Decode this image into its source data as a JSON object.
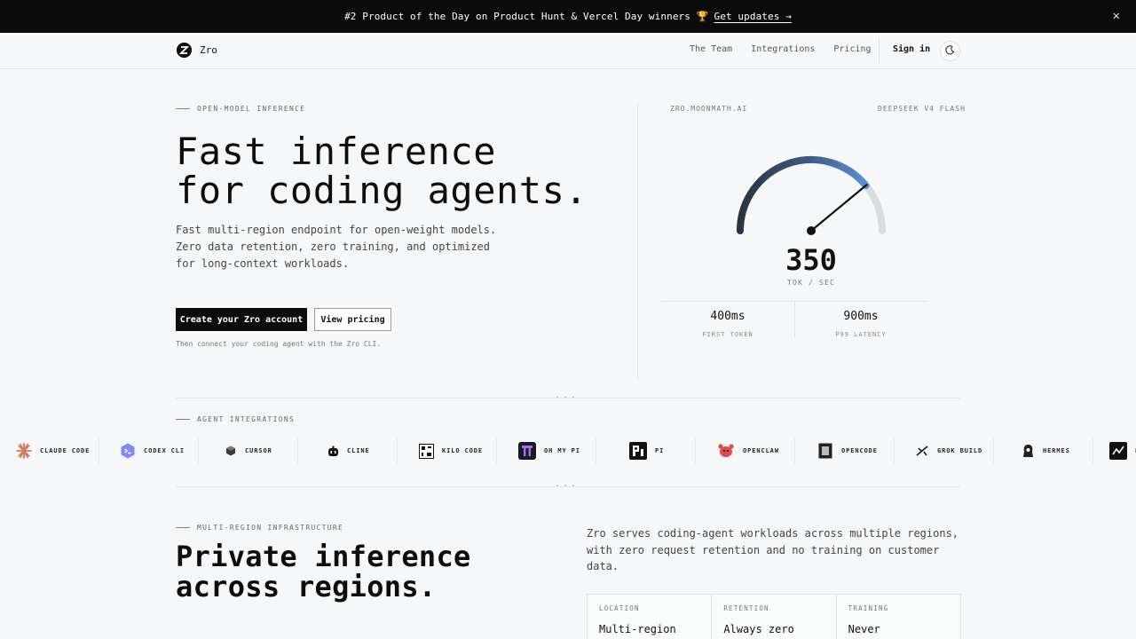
{
  "announcement": {
    "text": "#2 Product of the Day on Product Hunt & Vercel Day winners 🏆",
    "link": "Get updates →",
    "close_icon": "✕"
  },
  "nav": {
    "brand": "Zro",
    "links": [
      "The Team",
      "Integrations",
      "Pricing"
    ],
    "sign_in": "Sign in",
    "theme_icon": "moon-icon"
  },
  "hero": {
    "eyebrow": "OPEN-MODEL INFERENCE",
    "title_line1": "Fast inference",
    "title_line2": "for coding agents.",
    "desc_line1": "Fast multi-region endpoint for open-weight models.",
    "desc_line2": "Zero data retention, zero training, and optimized",
    "desc_line3": "for long-context workloads.",
    "primary_button": "Create your Zro account",
    "secondary_button": "View pricing",
    "hint": "Then connect your coding agent with the Zro CLI."
  },
  "speed_panel": {
    "host": "ZRO.MOONMATH.AI",
    "model": "DEEPSEEK V4 FLASH",
    "value": "350",
    "unit": "TOK / SEC",
    "gauge_fraction": 0.78,
    "stats": [
      {
        "value": "400ms",
        "label": "FIRST TOKEN"
      },
      {
        "value": "900ms",
        "label": "P99 LATENCY"
      }
    ]
  },
  "integrations": {
    "eyebrow": "AGENT INTEGRATIONS",
    "dots": "...",
    "agents": [
      {
        "label": "CLAUDE CODE",
        "icon": "claude-burst-icon",
        "color": "#d97757"
      },
      {
        "label": "CODEX CLI",
        "icon": "codex-terminal-icon",
        "color": "#6b7cf5"
      },
      {
        "label": "CURSOR",
        "icon": "cursor-cube-icon",
        "color": "#333333"
      },
      {
        "label": "CLINE",
        "icon": "cline-robot-icon",
        "color": "#111111"
      },
      {
        "label": "KILO CODE",
        "icon": "kilo-grid-icon",
        "color": "#111111"
      },
      {
        "label": "OH MY PI",
        "icon": "oh-my-pi-icon",
        "color": "#5a2ea6"
      },
      {
        "label": "PI",
        "icon": "pi-icon",
        "color": "#111111"
      },
      {
        "label": "OPENCLAW",
        "icon": "openclaw-icon",
        "color": "#e24a4a"
      },
      {
        "label": "OPENCODE",
        "icon": "opencode-icon",
        "color": "#222222"
      },
      {
        "label": "GROK BUILD",
        "icon": "grok-icon",
        "color": "#111111"
      },
      {
        "label": "HERMES",
        "icon": "hermes-icon",
        "color": "#222222"
      },
      {
        "label": "P",
        "icon": "trend-icon",
        "color": "#111111"
      }
    ]
  },
  "infrastructure": {
    "eyebrow": "MULTI-REGION INFRASTRUCTURE",
    "title_line1": "Private inference",
    "title_line2": "across regions.",
    "desc": "Zro serves coding-agent workloads across multiple regions, with zero request retention and no training on customer data.",
    "table": [
      {
        "key": "LOCATION",
        "value": "Multi-region"
      },
      {
        "key": "RETENTION",
        "value": "Always zero"
      },
      {
        "key": "TRAINING",
        "value": "Never"
      }
    ]
  }
}
